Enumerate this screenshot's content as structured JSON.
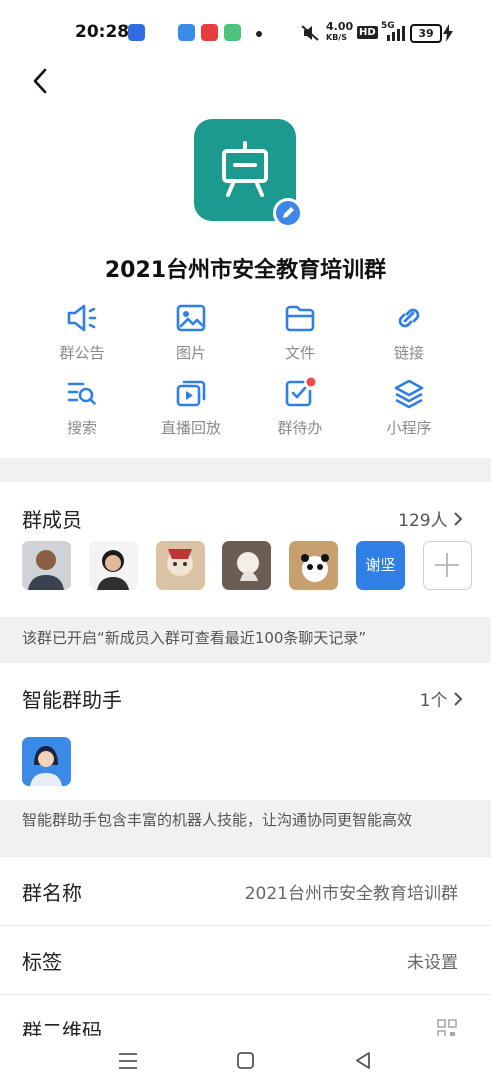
{
  "status_bar": {
    "time": "20:28",
    "net_speed_value": "4.00",
    "net_speed_unit": "KB/S",
    "hd_label": "HD",
    "network": "5G",
    "battery": "39"
  },
  "group": {
    "name": "2021台州市安全教育培训群",
    "avatar_color": "#1c9a8f"
  },
  "features": [
    {
      "label": "群公告",
      "icon": "announcement-icon"
    },
    {
      "label": "图片",
      "icon": "image-icon"
    },
    {
      "label": "文件",
      "icon": "folder-icon"
    },
    {
      "label": "链接",
      "icon": "link-icon"
    },
    {
      "label": "搜索",
      "icon": "search-list-icon"
    },
    {
      "label": "直播回放",
      "icon": "live-replay-icon"
    },
    {
      "label": "群待办",
      "icon": "todo-icon"
    },
    {
      "label": "小程序",
      "icon": "layers-icon"
    }
  ],
  "members": {
    "title": "群成员",
    "count": "129人",
    "named_avatar": "谢坚",
    "notice": "该群已开启“新成员入群可查看最近100条聊天记录”"
  },
  "assistant": {
    "title": "智能群助手",
    "count": "1个",
    "notice": "智能群助手包含丰富的机器人技能，让沟通协同更智能高效"
  },
  "settings": [
    {
      "key": "群名称",
      "value": "2021台州市安全教育培训群"
    },
    {
      "key": "标签",
      "value": "未设置"
    },
    {
      "key": "群二维码",
      "value": ""
    }
  ],
  "colors": {
    "accent": "#2f7fe6",
    "todo_dot": "#f24b4b"
  }
}
